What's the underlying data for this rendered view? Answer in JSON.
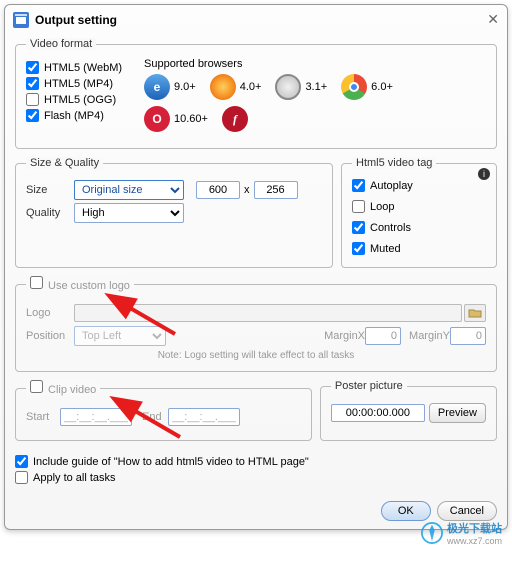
{
  "title": "Output setting",
  "video_format": {
    "legend": "Video format",
    "items": [
      {
        "label": "HTML5 (WebM)",
        "checked": true
      },
      {
        "label": "HTML5 (MP4)",
        "checked": true
      },
      {
        "label": "HTML5 (OGG)",
        "checked": false
      },
      {
        "label": "Flash (MP4)",
        "checked": true
      }
    ],
    "browsers_heading": "Supported browsers",
    "row1": [
      {
        "name": "ie",
        "ver": "9.0+"
      },
      {
        "name": "firefox",
        "ver": "4.0+"
      },
      {
        "name": "safari",
        "ver": "3.1+"
      },
      {
        "name": "chrome",
        "ver": "6.0+"
      }
    ],
    "row2": [
      {
        "name": "opera",
        "ver": "10.60+"
      },
      {
        "name": "flash",
        "ver": ""
      }
    ]
  },
  "size_quality": {
    "legend": "Size & Quality",
    "size_label": "Size",
    "size_value": "Original size",
    "width": "600",
    "height": "256",
    "x": "x",
    "quality_label": "Quality",
    "quality_value": "High"
  },
  "html5_tag": {
    "legend": "Html5 video tag",
    "items": [
      {
        "label": "Autoplay",
        "checked": true
      },
      {
        "label": "Loop",
        "checked": false
      },
      {
        "label": "Controls",
        "checked": true
      },
      {
        "label": "Muted",
        "checked": true
      }
    ]
  },
  "logo": {
    "legend": "Use custom logo",
    "legend_checked": false,
    "logo_label": "Logo",
    "position_label": "Position",
    "position_value": "Top Left",
    "marginx_label": "MarginX",
    "marginx_value": "0",
    "marginy_label": "MarginY",
    "marginy_value": "0",
    "note": "Note: Logo setting will take effect to all tasks"
  },
  "clip": {
    "legend": "Clip video",
    "legend_checked": false,
    "start_label": "Start",
    "start_value": "__:__:__.___",
    "end_label": "End",
    "end_value": "__:__:__.___"
  },
  "poster": {
    "legend": "Poster picture",
    "value": "00:00:00.000",
    "preview": "Preview"
  },
  "include_guide": {
    "label": "Include guide of \"How to add html5 video to HTML page\"",
    "checked": true
  },
  "apply_all": {
    "label": "Apply to all tasks",
    "checked": false
  },
  "buttons": {
    "ok": "OK",
    "cancel": "Cancel"
  },
  "watermark": {
    "brand": "极光下载站",
    "url": "www.xz7.com"
  }
}
